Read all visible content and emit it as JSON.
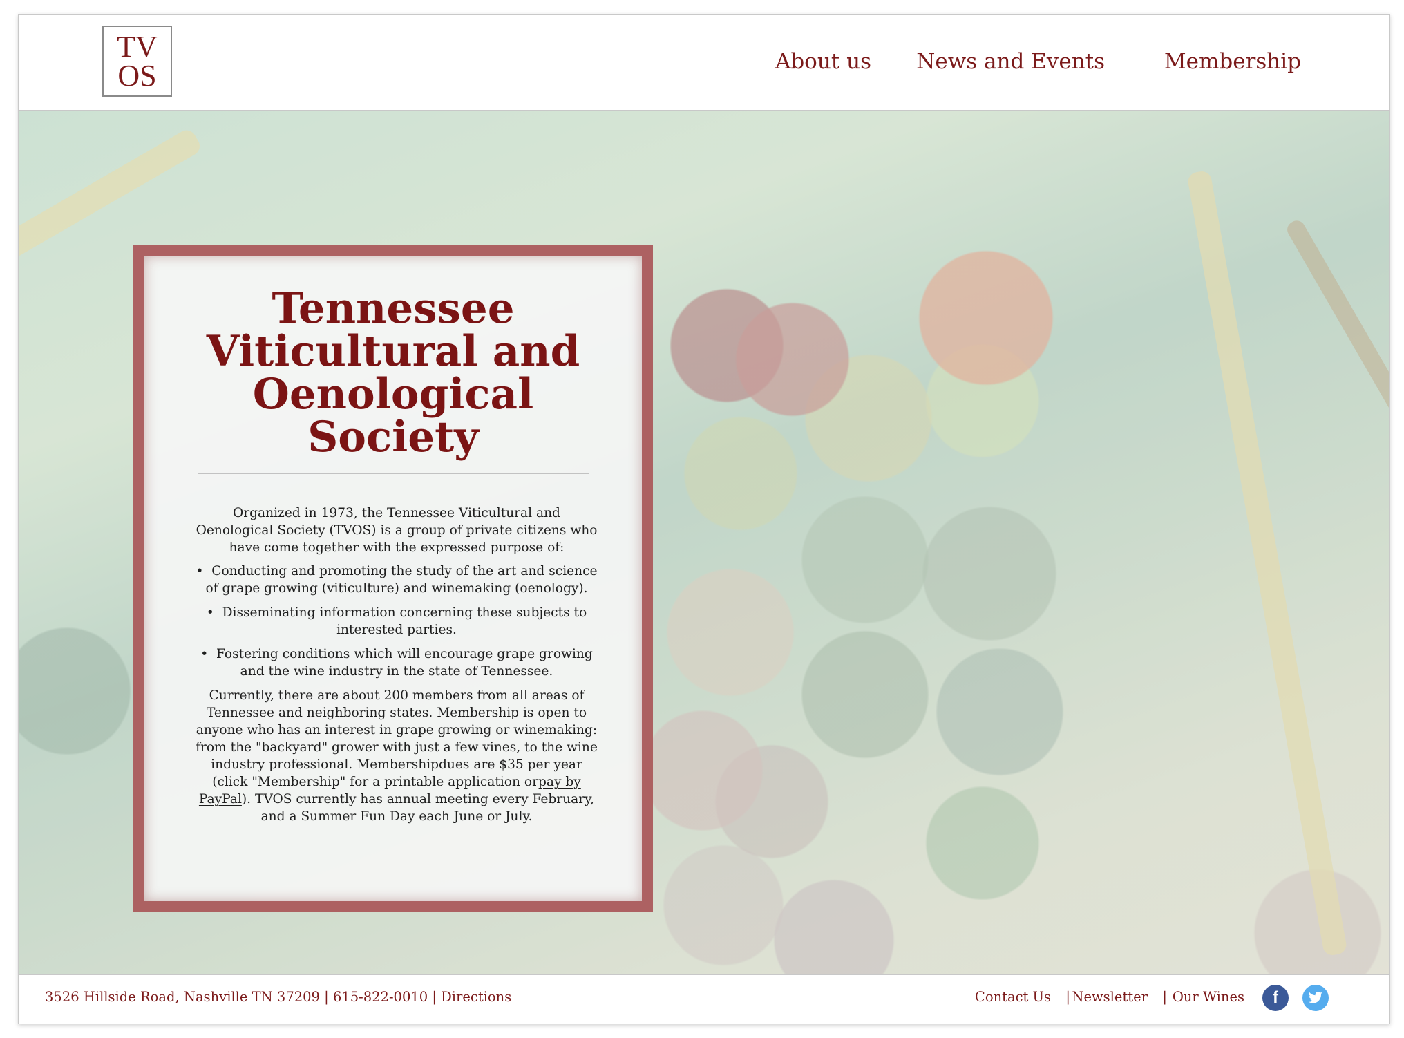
{
  "header": {
    "logo_line1": "TV",
    "logo_line2": "OS",
    "nav": [
      "About us",
      "News and Events",
      "Membership"
    ]
  },
  "card": {
    "title": "Tennessee Viticultural and Oenological Society",
    "intro": "Organized in 1973, the Tennessee Viticultural and Oenological Society (TVOS) is a group of private citizens who have come together with the expressed purpose of:",
    "bullets": [
      "Conducting and promoting the study of the art and science of grape growing (viticulture) and winemaking (oenology).",
      "Disseminating information concerning these subjects to interested parties.",
      "Fostering conditions which will encourage grape growing and the wine industry in the state of Tennessee."
    ],
    "closing_a": "Currently, there are about 200 members from all areas of Tennessee and neighboring states.  Membership is open to anyone who has an interest in grape growing or winemaking: from the \"backyard\" grower with just a few vines, to the wine industry professional.  ",
    "membership_link": "Membership",
    "closing_b": "dues are $35 per year (click \"Membership\" for a printable application or",
    "paypal_link": "pay by PayPal",
    "closing_c": ").  TVOS currently has annual meeting every February, and a Summer Fun Day each June or July."
  },
  "footer": {
    "address": "3526 Hillside Road, Nashville TN 37209",
    "phone": "615-822-0010",
    "directions": "Directions",
    "divider": "|",
    "links": [
      "Contact Us",
      "Newsletter",
      "Our Wines"
    ],
    "facebook_glyph": "f",
    "twitter_glyph": "🐦"
  },
  "colors": {
    "brand": "#7b1a1a",
    "card_border": "#a04648",
    "facebook": "#3b5998",
    "twitter": "#55acee"
  }
}
